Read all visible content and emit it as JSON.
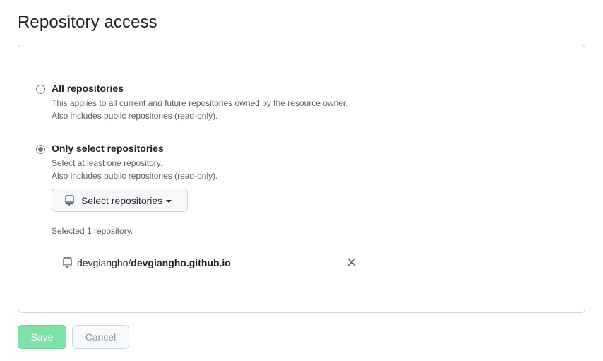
{
  "page": {
    "title": "Repository access"
  },
  "options": {
    "all": {
      "label": "All repositories",
      "desc_line1_pre": "This applies to all current ",
      "desc_line1_em": "and",
      "desc_line1_post": " future repositories owned by the resource owner.",
      "desc_line2": "Also includes public repositories (read-only).",
      "selected": false
    },
    "select": {
      "label": "Only select repositories",
      "desc_line1": "Select at least one repository.",
      "desc_line2": "Also includes public repositories (read-only).",
      "selected": true
    }
  },
  "select_button": {
    "label": "Select repositories",
    "icon": "repo-icon"
  },
  "selected_count_text": "Selected 1 repository.",
  "repositories": [
    {
      "owner": "devgiangho/",
      "name": "devgiangho.github.io",
      "icon": "repo-icon",
      "remove_icon": "close-icon"
    }
  ],
  "actions": {
    "save_label": "Save",
    "cancel_label": "Cancel"
  },
  "colors": {
    "save_bg": "#7ee2a8",
    "border": "#d0d7de",
    "muted_text": "#57606a"
  }
}
